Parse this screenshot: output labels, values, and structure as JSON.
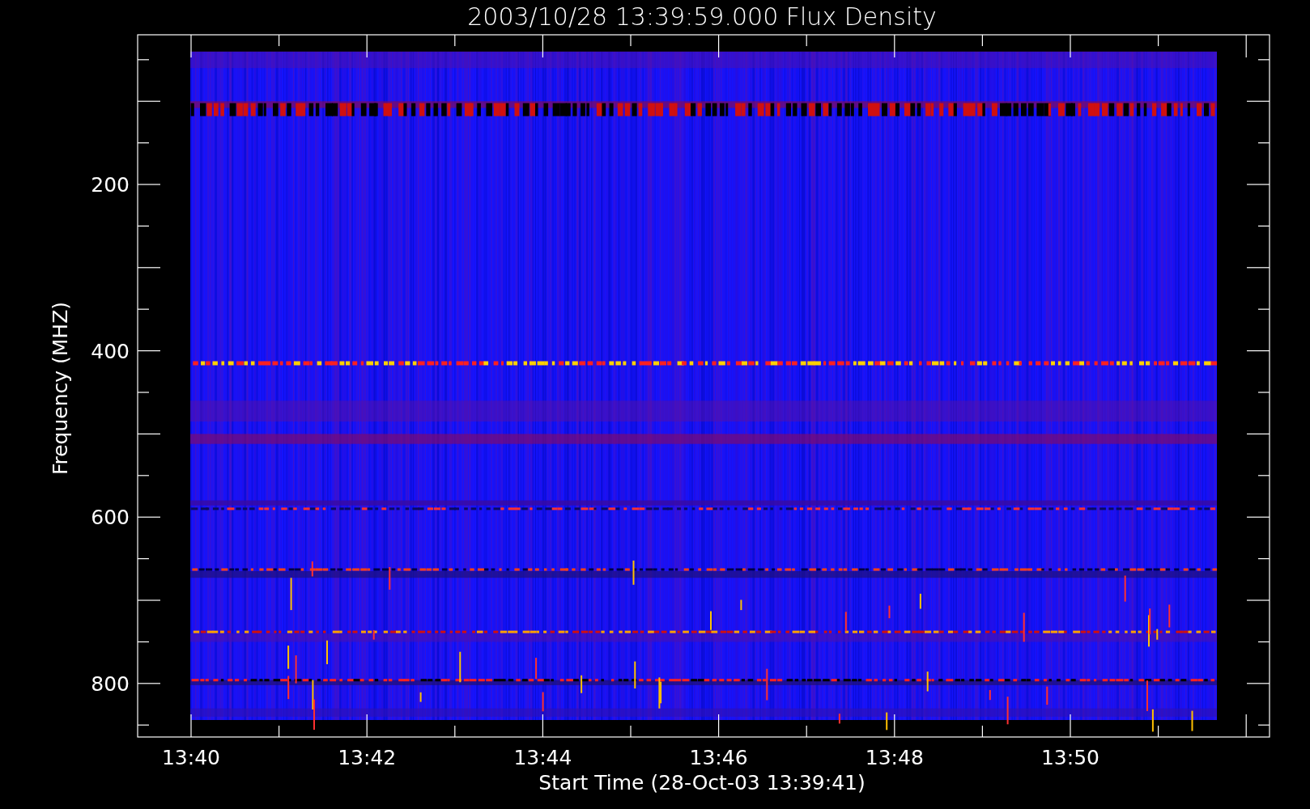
{
  "title": "2003/10/28 13:39:59.000 Flux Density",
  "plot": {
    "ylabel": "Frequency (MHZ)",
    "xlabel": "Start Time (28-Oct-03 13:39:41)",
    "yticks": [
      "200",
      "400",
      "600",
      "800"
    ],
    "xticks": [
      "13:40",
      "13:42",
      "13:44",
      "13:46",
      "13:48",
      "13:50"
    ]
  }
}
